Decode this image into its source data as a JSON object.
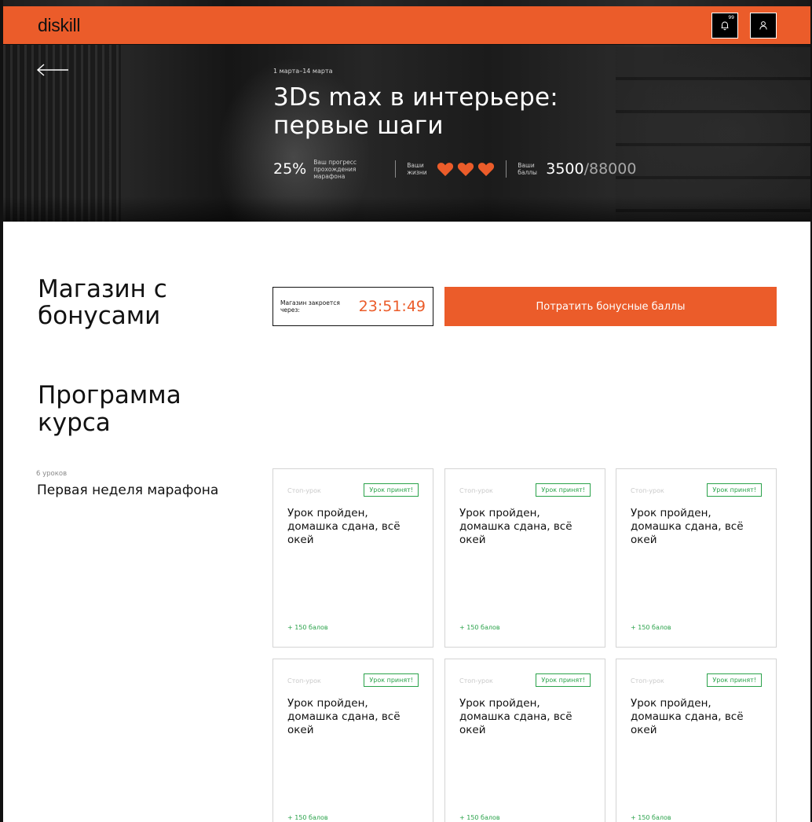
{
  "header": {
    "logo": "diskill",
    "notifications_count": "99",
    "bell_icon": "bell-icon",
    "user_icon": "user-icon",
    "brand_color": "#eb5c2a"
  },
  "hero": {
    "back_icon": "arrow-left-icon",
    "dates": "1 марта–14 марта",
    "title": "3Ds max в интерьере: первые шаги",
    "progress": {
      "value": "25%",
      "label": "Ваш прогресс прохождения марафона"
    },
    "lives": {
      "label": "Ваши жизни",
      "count": 3,
      "icon": "heart-icon"
    },
    "score": {
      "label": "Ваши баллы",
      "current": "3500",
      "total": "/88000"
    }
  },
  "shop": {
    "title": "Магазин с бонусами",
    "timer_label": "Магазин закроется через:",
    "timer_value": "23:51:49",
    "spend_button": "Потратить бонусные баллы"
  },
  "program": {
    "title": "Программа курса",
    "weeks": [
      {
        "count": "6 уроков",
        "title": "Первая неделя марафона",
        "lessons": [
          {
            "tag": "Стоп-урок",
            "badge": "Урок принят!",
            "text": "Урок пройден, домашка сдана, всё окей",
            "points": "+ 150 балов"
          },
          {
            "tag": "Стоп-урок",
            "badge": "Урок принят!",
            "text": "Урок пройден, домашка сдана, всё окей",
            "points": "+ 150 балов"
          },
          {
            "tag": "Стоп-урок",
            "badge": "Урок принят!",
            "text": "Урок пройден, домашка сдана, всё окей",
            "points": "+ 150 балов"
          },
          {
            "tag": "Стоп-урок",
            "badge": "Урок принят!",
            "text": "Урок пройден, домашка сдана, всё окей",
            "points": "+ 150 балов"
          },
          {
            "tag": "Стоп-урок",
            "badge": "Урок принят!",
            "text": "Урок пройден, домашка сдана, всё окей",
            "points": "+ 150 балов"
          },
          {
            "tag": "Стоп-урок",
            "badge": "Урок принят!",
            "text": "Урок пройден, домашка сдана, всё окей",
            "points": "+ 150 балов"
          }
        ]
      }
    ]
  }
}
